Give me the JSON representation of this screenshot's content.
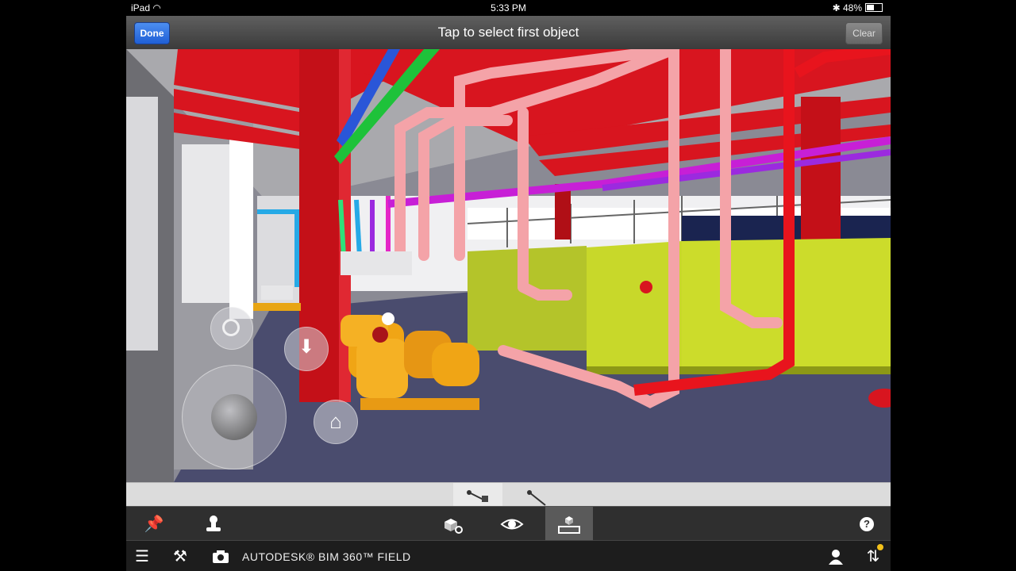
{
  "status_bar": {
    "device": "iPad",
    "time": "5:33 PM",
    "battery": "48%"
  },
  "nav": {
    "done_label": "Done",
    "title": "Tap to select first object",
    "clear_label": "Clear"
  },
  "app": {
    "brand": "AUTODESK® BIM 360™ FIELD"
  },
  "icons": {
    "pin": "pin-icon",
    "stamp": "stamp-icon",
    "objects": "objects-icon",
    "eye": "eye-icon",
    "measure": "measure-icon",
    "help": "help-icon",
    "menu": "menu-icon",
    "tools": "tools-icon",
    "camera": "camera-icon",
    "user": "user-icon",
    "sync": "sync-icon"
  },
  "colors": {
    "accent": "#2a6fe0",
    "sync_badge": "#f3c11a"
  }
}
